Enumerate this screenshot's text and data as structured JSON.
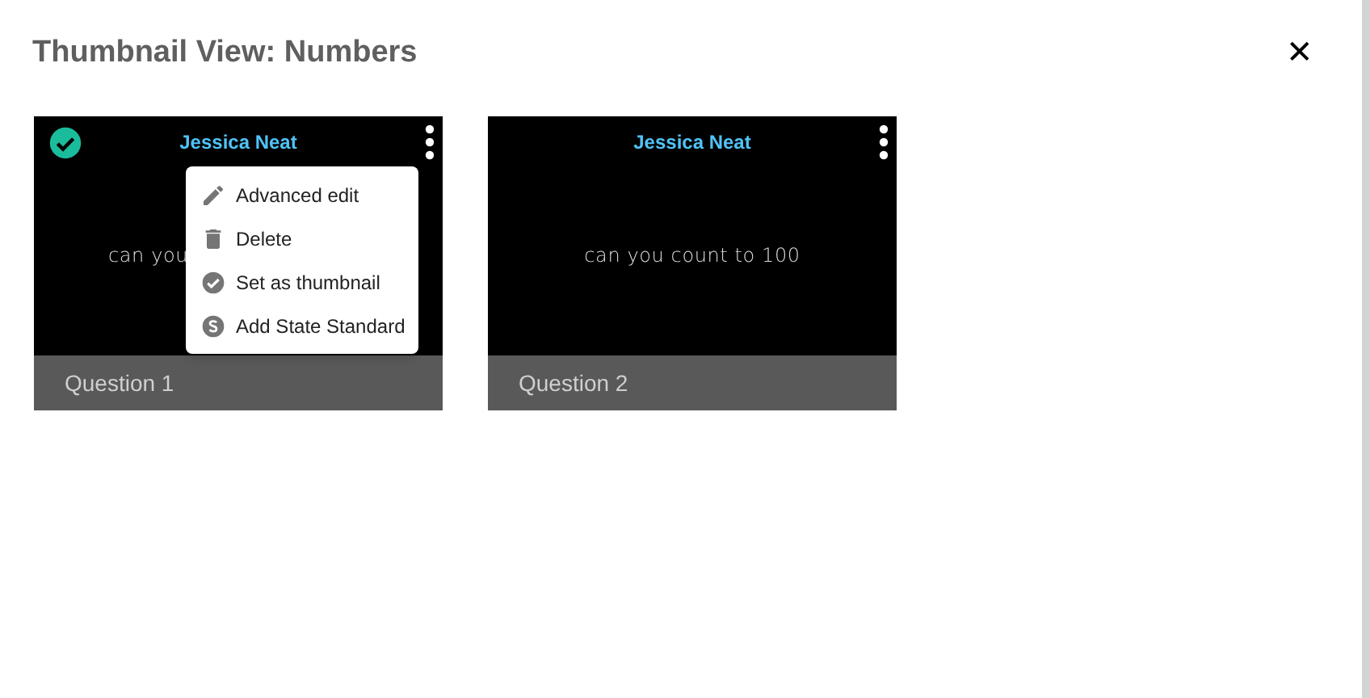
{
  "dialog": {
    "title": "Thumbnail View: Numbers",
    "close": "✕"
  },
  "cards": [
    {
      "author": "Jessica Neat",
      "slide_text": "can you",
      "label": "Question 1",
      "thumbnail": true,
      "menu": [
        {
          "kind": "edit",
          "label": "Advanced edit"
        },
        {
          "kind": "delete",
          "label": "Delete"
        },
        {
          "kind": "thumbnail",
          "label": "Set as thumbnail"
        },
        {
          "kind": "standard",
          "label": "Add State Standard"
        }
      ]
    },
    {
      "author": "Jessica Neat",
      "slide_text": "can you count to 100",
      "label": "Question 2",
      "thumbnail": false
    }
  ]
}
